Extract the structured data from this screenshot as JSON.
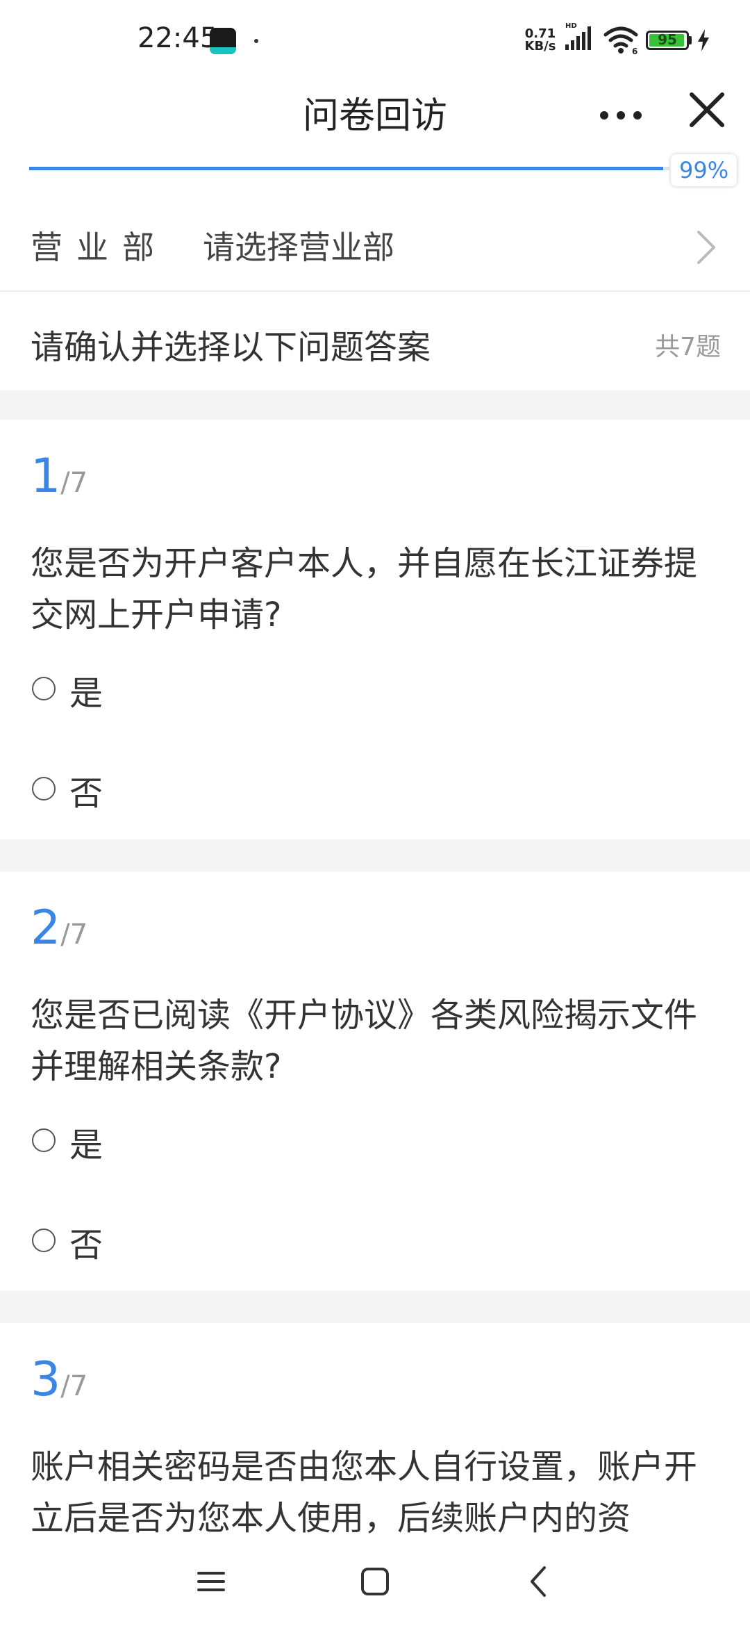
{
  "status": {
    "time": "22:45",
    "speed_value": "0.71",
    "speed_unit": "KB/s",
    "battery": "95",
    "battery_level": 0.95
  },
  "header": {
    "title": "问卷回访",
    "more_icon": "more-horizontal-icon",
    "close_icon": "close-icon"
  },
  "progress": {
    "label": "99%",
    "value": 0.99,
    "color": "#3a86e6"
  },
  "department": {
    "label": "营业部",
    "value": "请选择营业部"
  },
  "intro": {
    "text": "请确认并选择以下问题答案",
    "count": "共7题"
  },
  "questions": [
    {
      "number": "1",
      "total": "/7",
      "text": "您是否为开户客户本人，并自愿在长江证券提交网上开户申请?",
      "options": [
        "是",
        "否"
      ]
    },
    {
      "number": "2",
      "total": "/7",
      "text": "您是否已阅读《开户协议》各类风险揭示文件并理解相关条款?",
      "options": [
        "是",
        "否"
      ]
    },
    {
      "number": "3",
      "total": "/7",
      "text": "账户相关密码是否由您本人自行设置，账户开立后是否为您本人使用，后续账户内的资"
    }
  ],
  "colors": {
    "accent": "#3a86e6",
    "separator": "#f4f4f4"
  }
}
